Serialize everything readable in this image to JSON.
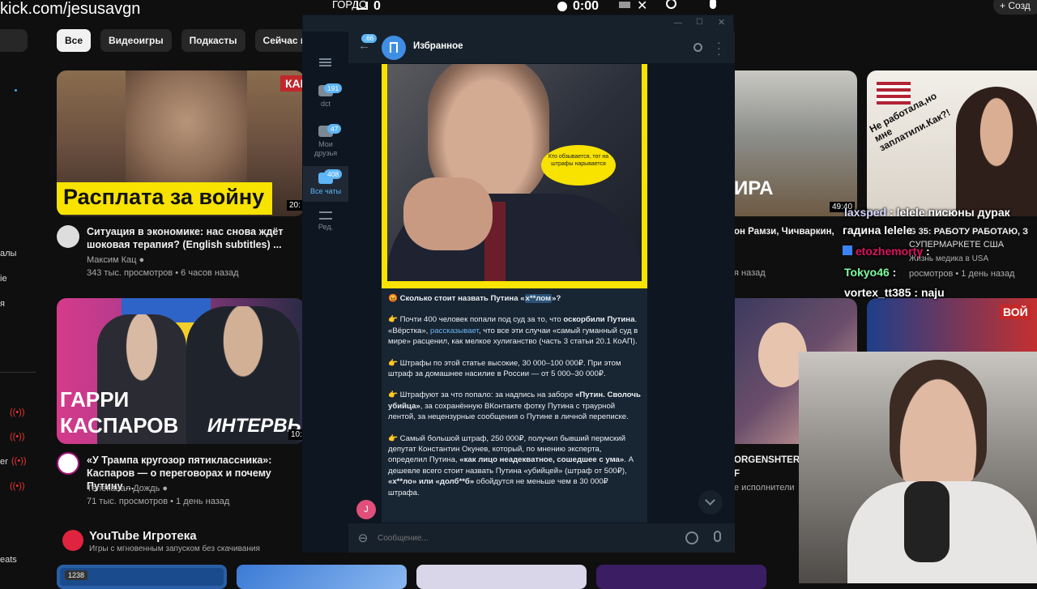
{
  "stream": {
    "url": "kick.com/jesusavgn",
    "overlay_label": "ГОРДО",
    "cart_count": "0",
    "timer": "0:00"
  },
  "youtube": {
    "create_label": "Созд",
    "chips": [
      "Все",
      "Видеоигры",
      "Подкасты",
      "Сейчас в эфире"
    ],
    "rail_labels": [
      "алы",
      "ie",
      "я",
      "er",
      "eats"
    ],
    "videos": [
      {
        "overlay_text": "Расплата за войну",
        "corner_text": "КАЙ",
        "duration": "20:",
        "title": "Ситуация в экономике: нас снова ждёт шоковая терапия? (English subtitles) ...",
        "channel": "Максим Кац",
        "meta": "343 тыс. просмотров • 6 часов назад"
      },
      {
        "overlay_text_1": "ГАРРИ",
        "overlay_text_2": "КАСПАРОВ",
        "overlay_text_3": "ИНТЕРВЬ",
        "duration": "10:",
        "title": "«У Трампа кругозор пятиклассника»: Каспаров — о переговорах и почему Путину ...",
        "channel": "Телеканал Дождь",
        "meta": "71 тыс. просмотров • 1 день назад"
      },
      {
        "overlay_text": "ИРА",
        "duration": "49:40",
        "title": "он Рамзи, Чичваркин,",
        "meta": "я назад"
      },
      {
        "bubble": "Не работала,но мне заплатили.Как?!",
        "title_partial": "G 35: РАБОТУ РАБОТАЮ, З",
        "title_partial_2": "СУПЕРМАРКЕТЕ США",
        "channel_partial": "Жизнь медика в USA",
        "meta": "росмотров • 1 день назад"
      },
      {
        "title": "ORGENSHTERN",
        "title_2": "F",
        "meta": "е исполнители"
      },
      {
        "overlay_text": "ВОЙ"
      }
    ],
    "playables": {
      "title": "YouTube Игротека",
      "subtitle": "Игры с мгновенным запуском без скачивания",
      "first_count": "1238"
    }
  },
  "telegram": {
    "chat_title": "Избранное",
    "back_badge": "66",
    "folders": [
      {
        "label": "dct",
        "badge": "191"
      },
      {
        "label": "Мои друзья",
        "badge": "47"
      },
      {
        "label": "Все чаты",
        "badge": "408"
      },
      {
        "label": "Ред.",
        "badge": ""
      }
    ],
    "image_bubble": "Кто обзывается, тот на штрафы нарывается",
    "avatar_letter": "J",
    "input_placeholder": "Сообщение...",
    "message": {
      "p1_emoji": "😡",
      "p1_a": " Сколько стоит назвать Путина «",
      "p1_spoiler": "х**лом",
      "p1_b": "»?",
      "p2_emoji": "👉",
      "p2_a": " Почти 400 человек попали под суд за то, что ",
      "p2_bold": "оскорбили Путина",
      "p2_b": ". «Вёрстка», ",
      "p2_link": "рассказывает",
      "p2_c": ", что все эти случаи «самый гуманный суд в мире» расценил, как мелкое хулиганство (часть 3 статьи 20.1 КоАП).",
      "p3_emoji": "👉",
      "p3": " Штрафы по этой статье высокие, 30 000–100 000₽. При этом штраф за домашнее насилие в России — от 5 000–30 000₽.",
      "p4_emoji": "👉",
      "p4_a": " Штрафуют за что попало: за надпись на заборе ",
      "p4_bold": "«Путин. Сволочь убийца»",
      "p4_b": ", за сохранённую ВКонтакте фотку Путина с траурной лентой, за нецензурные сообщения о Путине в личной переписке.",
      "p5_emoji": "👉",
      "p5_a": " Самый большой штраф, 250 000₽, получил бывший пермский депутат Константин Окунев, который, по мнению эксперта, определил Путина, ",
      "p5_bold": "«как лицо неадекватное, сошедшее с ума»",
      "p5_b": ". А дешевле всего стоит назвать Путина «убийцей» (штраф от 500₽), ",
      "p5_bold2": "«х**ло» или «долб**б»",
      "p5_c": " обойдутся не меньше чем в 30 000₽ штрафа."
    }
  },
  "stream_chat": [
    {
      "user": "laxsped",
      "text": " : lelele писюны дурак"
    },
    {
      "user": "",
      "text": "гадина lelele"
    },
    {
      "user": "etozhemorty",
      "text": " :"
    },
    {
      "user": "Tokyo46",
      "text": " :"
    },
    {
      "user": "vortex_tt385",
      "text": " :  naju"
    }
  ],
  "colors": {
    "yt_bg": "#0f0f0f",
    "tg_bg": "#0e1621",
    "tg_panel": "#17212b",
    "tg_accent": "#5eb5f7",
    "msg_bubble": "#182533",
    "yellow_frame": "#f7e200"
  }
}
